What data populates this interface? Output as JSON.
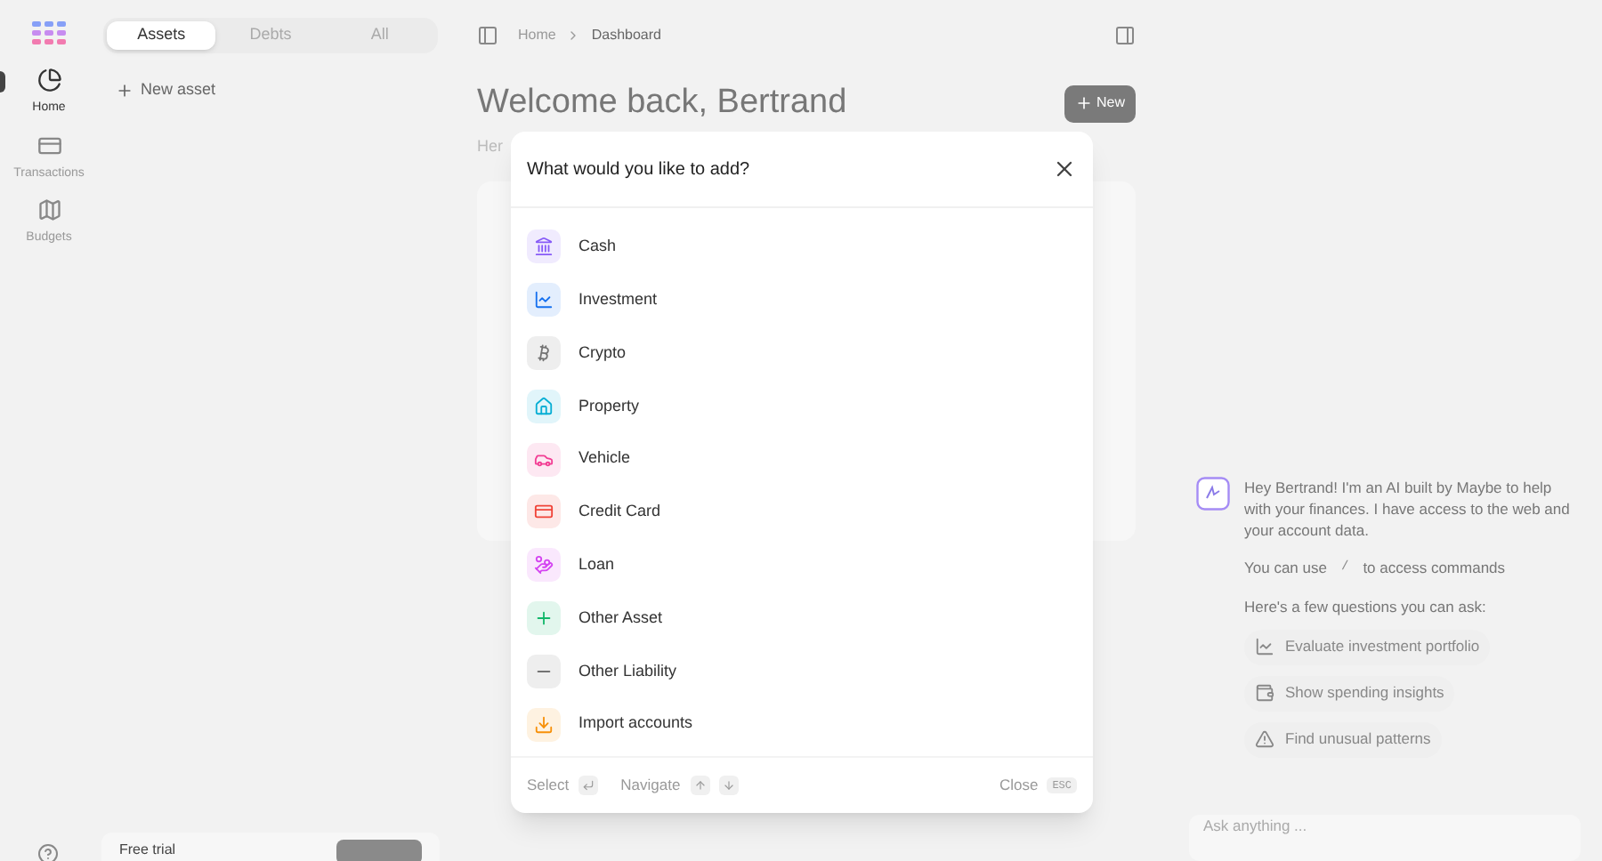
{
  "nav": [
    {
      "label": "Home",
      "kind": "home",
      "selected": true
    },
    {
      "label": "Transactions",
      "kind": "transactions",
      "selected": false
    },
    {
      "label": "Budgets",
      "kind": "budgets",
      "selected": false
    }
  ],
  "sidebar": {
    "tabs": [
      {
        "label": "Assets",
        "selected": true
      },
      {
        "label": "Debts",
        "selected": false
      },
      {
        "label": "All",
        "selected": false
      }
    ],
    "new_button": "New asset",
    "trial": {
      "title": "Free trial"
    }
  },
  "breadcrumb": [
    "Home",
    "Dashboard"
  ],
  "header": {
    "title": "Welcome back, Bertrand",
    "subtitle": "Her",
    "new_button": "New"
  },
  "dialog": {
    "title": "What would you like to add?",
    "items": [
      {
        "label": "Cash",
        "kind": "cash",
        "color": "#875bf7"
      },
      {
        "label": "Investment",
        "kind": "investment",
        "color": "#1570ef"
      },
      {
        "label": "Crypto",
        "kind": "crypto",
        "color": "#737373"
      },
      {
        "label": "Property",
        "kind": "property",
        "color": "#06aed4"
      },
      {
        "label": "Vehicle",
        "kind": "vehicle",
        "color": "#f23e94"
      },
      {
        "label": "Credit Card",
        "kind": "credit_card",
        "color": "#f04438"
      },
      {
        "label": "Loan",
        "kind": "loan",
        "color": "#d444f1"
      },
      {
        "label": "Other Asset",
        "kind": "other_asset",
        "color": "#12b76a"
      },
      {
        "label": "Other Liability",
        "kind": "other_liability",
        "color": "#737373"
      },
      {
        "label": "Import accounts",
        "kind": "import",
        "color": "#f79009"
      }
    ],
    "footer": {
      "select": "Select",
      "navigate": "Navigate",
      "close": "Close",
      "close_key": "ESC"
    }
  },
  "chat": {
    "intro": "Hey Bertrand! I'm an AI built by Maybe to help with your finances. I have access to the web and your account data.",
    "commands_before": "You can use",
    "commands_key": "/",
    "commands_after": "to access commands",
    "questions_title": "Here's a few questions you can ask:",
    "questions": [
      {
        "label": "Evaluate investment portfolio",
        "kind": "chart"
      },
      {
        "label": "Show spending insights",
        "kind": "wallet"
      },
      {
        "label": "Find unusual patterns",
        "kind": "alert"
      }
    ],
    "input": {
      "placeholder": "Ask anything ..."
    }
  }
}
